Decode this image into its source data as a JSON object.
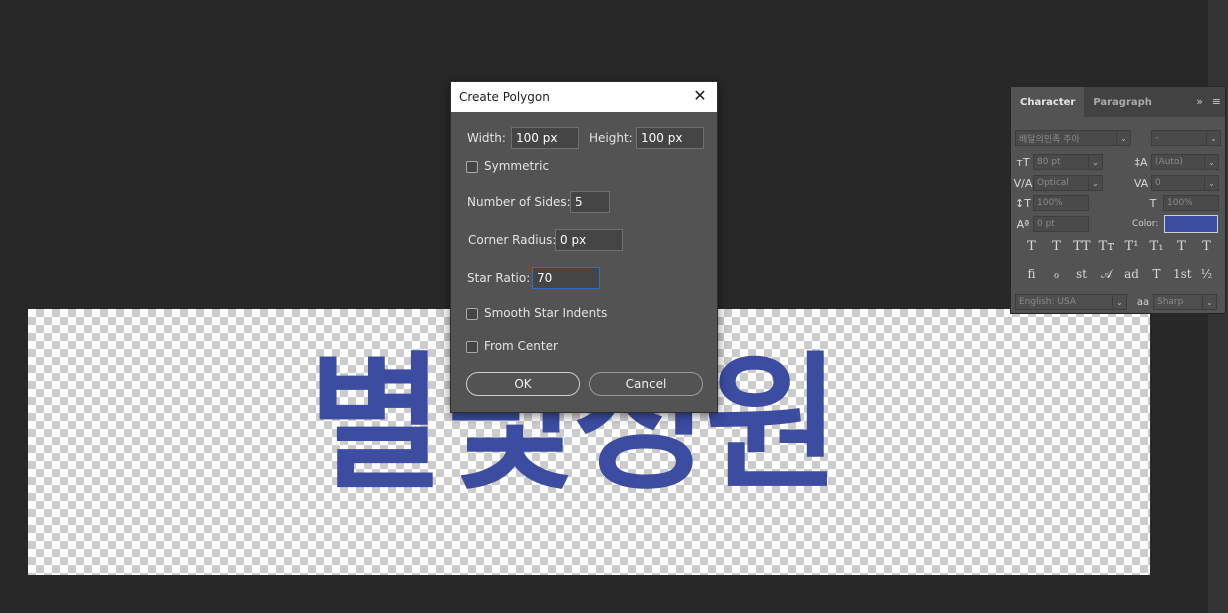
{
  "canvas": {
    "text": "별빛정원",
    "text_color": "#3b4ca1"
  },
  "character_panel": {
    "tabs": [
      "Character",
      "Paragraph"
    ],
    "collapse_glyph": "»",
    "menu_glyph": "≡",
    "font_family": "배달의민족 주아",
    "font_style": "-",
    "font_size": "80 pt",
    "leading": "(Auto)",
    "kerning": "Optical",
    "tracking": "0",
    "vertical_scale": "100%",
    "horizontal_scale": "100%",
    "baseline_shift": "0 pt",
    "color_label": "Color:",
    "color_swatch": "#3b4ca1",
    "language": "English: USA",
    "antialias_icon": "aa",
    "antialias": "Sharp",
    "type_buttons": [
      "T",
      "T",
      "TT",
      "Tт",
      "T¹",
      "T₁",
      "T",
      "T"
    ],
    "opentype_buttons": [
      "ﬁ",
      "ℴ",
      "st",
      "𝒜",
      "ad",
      "T",
      "1st",
      "½"
    ]
  },
  "dialog": {
    "title": "Create Polygon",
    "close_glyph": "✕",
    "width_label": "Width:",
    "width_value": "100 px",
    "height_label": "Height:",
    "height_value": "100 px",
    "symmetric_label": "Symmetric",
    "sides_label": "Number of Sides:",
    "sides_value": "5",
    "corner_label": "Corner Radius:",
    "corner_value": "0 px",
    "star_label": "Star Ratio:",
    "star_value": "70",
    "smooth_label": "Smooth Star Indents",
    "center_label": "From Center",
    "ok_label": "OK",
    "cancel_label": "Cancel"
  }
}
